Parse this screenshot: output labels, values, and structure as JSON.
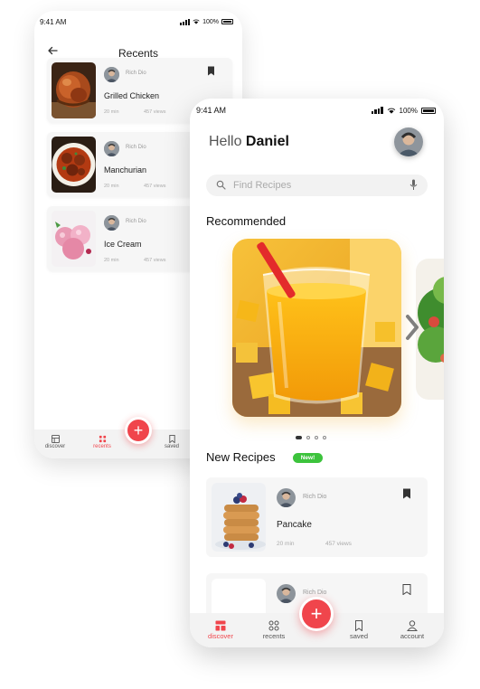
{
  "colors": {
    "accent": "#f0454c",
    "badge": "#3cc33c",
    "card_bg": "#f6f6f6",
    "nav_bg": "#f3f3f3"
  },
  "back_screen": {
    "status": {
      "time": "9:41 AM",
      "battery": "100%"
    },
    "header": {
      "title": "Recents",
      "back_icon": "arrow-left-icon"
    },
    "recents": [
      {
        "author": "Rich Dio",
        "name": "Grilled Chicken",
        "time": "20 min",
        "views": "457 views",
        "bookmark_icon": "bookmark-filled-icon"
      },
      {
        "author": "Rich Dio",
        "name": "Manchurian",
        "time": "20 min",
        "views": "457 views"
      },
      {
        "author": "Rich Dio",
        "name": "Ice Cream",
        "time": "20 min",
        "views": "457 views"
      }
    ],
    "nav": [
      {
        "label": "discover",
        "icon": "discover-icon"
      },
      {
        "label": "recents",
        "icon": "grid-icon",
        "active": true
      },
      {
        "label": "saved",
        "icon": "bookmark-icon"
      }
    ],
    "fab": "+"
  },
  "front_screen": {
    "status": {
      "time": "9:41 AM",
      "battery": "100%"
    },
    "greeting": {
      "hello": "Hello",
      "name": "Daniel"
    },
    "search": {
      "placeholder": "Find Recipes",
      "value": ""
    },
    "recommended": {
      "title": "Recommended",
      "page_count": 4,
      "active_page": 1
    },
    "new_recipes": {
      "title": "New Recipes",
      "badge": "New!",
      "items": [
        {
          "author": "Rich Dio",
          "name": "Pancake",
          "time": "20 min",
          "views": "457 views",
          "bookmark_icon": "bookmark-filled-icon"
        },
        {
          "author": "Rich Dio",
          "name": "",
          "time": "",
          "views": "",
          "bookmark_icon": "bookmark-outline-icon"
        }
      ]
    },
    "nav": [
      {
        "label": "discover",
        "icon": "discover-icon",
        "active": true
      },
      {
        "label": "recents",
        "icon": "grid-icon"
      },
      {
        "label": "saved",
        "icon": "bookmark-icon"
      },
      {
        "label": "account",
        "icon": "user-icon"
      }
    ],
    "fab": "+"
  }
}
